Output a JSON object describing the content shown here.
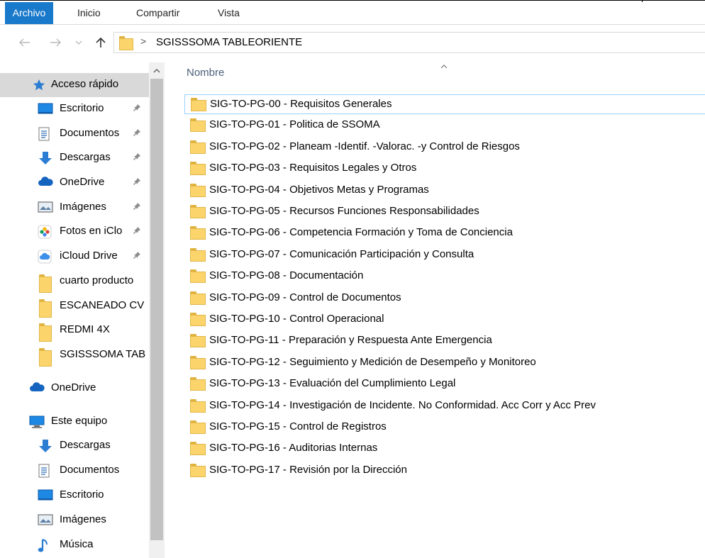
{
  "ribbon": {
    "tabs": [
      "Archivo",
      "Inicio",
      "Compartir",
      "Vista"
    ]
  },
  "nav": {
    "back_icon": "back-arrow-icon",
    "forward_icon": "forward-arrow-icon",
    "recent_icon": "chevron-down-icon",
    "up_icon": "up-arrow-icon"
  },
  "address": {
    "separator": ">",
    "path": "SGISSSOMA TABLEORIENTE"
  },
  "sidebar": {
    "items": [
      {
        "label": "Acceso rápido",
        "icon": "star-icon",
        "pinned": false
      },
      {
        "label": "Escritorio",
        "icon": "desktop-icon",
        "pinned": true
      },
      {
        "label": "Documentos",
        "icon": "documents-icon",
        "pinned": true
      },
      {
        "label": "Descargas",
        "icon": "download-icon",
        "pinned": true
      },
      {
        "label": "OneDrive",
        "icon": "cloud-icon",
        "pinned": true
      },
      {
        "label": "Imágenes",
        "icon": "pictures-icon",
        "pinned": true
      },
      {
        "label": "Fotos en iClo",
        "icon": "photos-icon",
        "pinned": true
      },
      {
        "label": "iCloud Drive",
        "icon": "icloud-icon",
        "pinned": true
      },
      {
        "label": "cuarto producto",
        "icon": "folder-icon",
        "pinned": false
      },
      {
        "label": "ESCANEADO CV",
        "icon": "folder-icon",
        "pinned": false
      },
      {
        "label": "REDMI 4X",
        "icon": "folder-icon",
        "pinned": false
      },
      {
        "label": "SGISSSOMA TAB",
        "icon": "folder-icon",
        "pinned": false
      },
      {
        "label": "OneDrive",
        "icon": "cloud-icon",
        "pinned": false
      },
      {
        "label": "Este equipo",
        "icon": "computer-icon",
        "pinned": false
      },
      {
        "label": "Descargas",
        "icon": "download-icon",
        "pinned": false
      },
      {
        "label": "Documentos",
        "icon": "documents-icon",
        "pinned": false
      },
      {
        "label": "Escritorio",
        "icon": "desktop-icon",
        "pinned": false
      },
      {
        "label": "Imágenes",
        "icon": "pictures-icon",
        "pinned": false
      },
      {
        "label": "Música",
        "icon": "music-icon",
        "pinned": false
      }
    ]
  },
  "content": {
    "column_header": "Nombre",
    "sort_icon": "chevron-up-icon",
    "files": [
      "SIG-TO-PG-00 - Requisitos Generales",
      "SIG-TO-PG-01 - Politica de SSOMA",
      "SIG-TO-PG-02 - Planeam -Identif. -Valorac. -y Control de Riesgos",
      "SIG-TO-PG-03 - Requisitos Legales y Otros",
      "SIG-TO-PG-04 - Objetivos Metas y Programas",
      "SIG-TO-PG-05 - Recursos Funciones Responsabilidades",
      "SIG-TO-PG-06 - Competencia Formación  y Toma de Conciencia",
      "SIG-TO-PG-07 - Comunicación Participación y Consulta",
      "SIG-TO-PG-08 - Documentación",
      "SIG-TO-PG-09 - Control de Documentos",
      "SIG-TO-PG-10 - Control Operacional",
      "SIG-TO-PG-11 - Preparación y Respuesta Ante Emergencia",
      "SIG-TO-PG-12 - Seguimiento y Medición de Desempeño y Monitoreo",
      "SIG-TO-PG-13 - Evaluación del Cumplimiento Legal",
      "SIG-TO-PG-14 - Investigación de Incidente. No Conformidad. Acc Corr y Acc Prev",
      "SIG-TO-PG-15 - Control de Registros",
      "SIG-TO-PG-16 - Auditorias Internas",
      "SIG-TO-PG-17 - Revisión por la Dirección"
    ]
  },
  "colors": {
    "accent": "#1979ca",
    "folder": "#fbd46b",
    "header_text": "#4c607a",
    "selected_nav": "#d9d9d9"
  }
}
